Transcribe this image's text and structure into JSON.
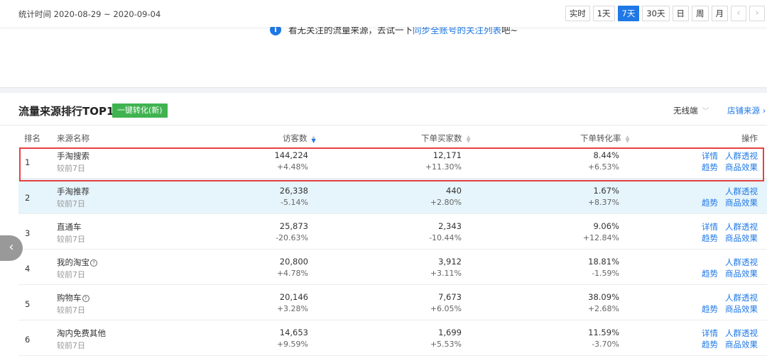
{
  "header": {
    "stat_range": "统计时间 2020-08-29 ~ 2020-09-04",
    "periods": [
      "实时",
      "1天",
      "7天",
      "30天",
      "日",
      "周",
      "月"
    ],
    "active_period": "7天",
    "prev_icon": "chevron-left-icon",
    "next_icon": "chevron-right-icon"
  },
  "notice": {
    "icon": "info-icon",
    "text_before": "看无关注的流量来源，去试一下 ",
    "link": "同步全账号的关注列表",
    "text_after": " 吧~"
  },
  "ranking": {
    "title": "流量来源排行TOP10",
    "badge": "一键转化(新)",
    "device_select": "无线端",
    "store_link": "店铺来源 ›",
    "columns": {
      "rank": "排名",
      "source": "来源名称",
      "visitors": "访客数",
      "buyers": "下单买家数",
      "conversion": "下单转化率",
      "ops": "操作"
    },
    "rows": [
      {
        "rank": "1",
        "name": "手淘搜索",
        "sub": "较前7日",
        "help": false,
        "visitors": "144,224",
        "visitors_delta": "+4.48%",
        "buyers": "12,171",
        "buyers_delta": "+11.30%",
        "conversion": "8.44%",
        "conversion_delta": "+6.53%",
        "op_detail": "详情",
        "op_crowd": "人群透视",
        "op_trend": "趋势",
        "op_effect": "商品效果"
      },
      {
        "rank": "2",
        "name": "手淘推荐",
        "sub": "较前7日",
        "help": false,
        "visitors": "26,338",
        "visitors_delta": "-5.14%",
        "buyers": "440",
        "buyers_delta": "+2.80%",
        "conversion": "1.67%",
        "conversion_delta": "+8.37%",
        "op_detail": "",
        "op_crowd": "人群透视",
        "op_trend": "趋势",
        "op_effect": "商品效果"
      },
      {
        "rank": "3",
        "name": "直通车",
        "sub": "较前7日",
        "help": false,
        "visitors": "25,873",
        "visitors_delta": "-20.63%",
        "buyers": "2,343",
        "buyers_delta": "-10.44%",
        "conversion": "9.06%",
        "conversion_delta": "+12.84%",
        "op_detail": "详情",
        "op_crowd": "人群透视",
        "op_trend": "趋势",
        "op_effect": "商品效果"
      },
      {
        "rank": "4",
        "name": "我的淘宝",
        "sub": "较前7日",
        "help": true,
        "visitors": "20,800",
        "visitors_delta": "+4.78%",
        "buyers": "3,912",
        "buyers_delta": "+3.11%",
        "conversion": "18.81%",
        "conversion_delta": "-1.59%",
        "op_detail": "",
        "op_crowd": "人群透视",
        "op_trend": "趋势",
        "op_effect": "商品效果"
      },
      {
        "rank": "5",
        "name": "购物车",
        "sub": "较前7日",
        "help": true,
        "visitors": "20,146",
        "visitors_delta": "+3.28%",
        "buyers": "7,673",
        "buyers_delta": "+6.05%",
        "conversion": "38.09%",
        "conversion_delta": "+2.68%",
        "op_detail": "",
        "op_crowd": "人群透视",
        "op_trend": "趋势",
        "op_effect": "商品效果"
      },
      {
        "rank": "6",
        "name": "淘内免费其他",
        "sub": "较前7日",
        "help": false,
        "visitors": "14,653",
        "visitors_delta": "+9.59%",
        "buyers": "1,699",
        "buyers_delta": "+5.53%",
        "conversion": "11.59%",
        "conversion_delta": "-3.70%",
        "op_detail": "详情",
        "op_crowd": "人群透视",
        "op_trend": "趋势",
        "op_effect": "商品效果"
      }
    ]
  },
  "overlay": {
    "highlighted_row": "1",
    "highlight_color": "#e84141",
    "side_icon": "chevron-left-icon"
  },
  "colors": {
    "accent": "#1f78e6",
    "badge_green": "#3fb34f",
    "row_hover": "#e6f4fb"
  }
}
